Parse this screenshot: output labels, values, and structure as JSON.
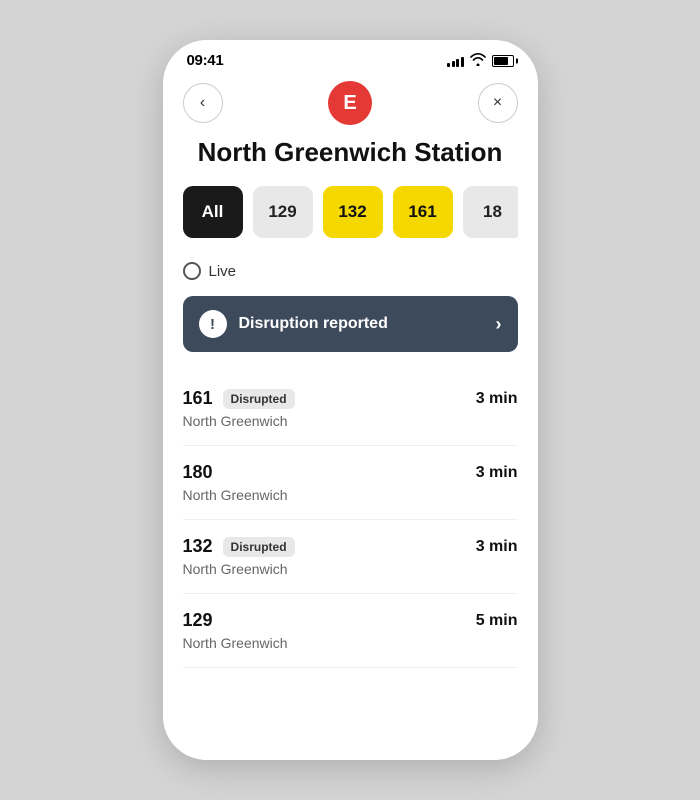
{
  "statusBar": {
    "time": "09:41",
    "locationArrow": "▶",
    "signalBars": [
      4,
      6,
      8,
      10,
      12
    ],
    "wifiSymbol": "wifi",
    "batteryFill": "80%"
  },
  "header": {
    "backLabel": "‹",
    "avatarLetter": "E",
    "closeLabel": "×"
  },
  "stationTitle": "North Greenwich Station",
  "routeTabs": [
    {
      "label": "All",
      "style": "active-black"
    },
    {
      "label": "129",
      "style": "inactive-gray"
    },
    {
      "label": "132",
      "style": "active-yellow"
    },
    {
      "label": "161",
      "style": "active-yellow"
    },
    {
      "label": "18",
      "style": "inactive-gray"
    }
  ],
  "liveLabel": "Live",
  "disruptionBanner": {
    "warningSymbol": "!",
    "text": "Disruption reported",
    "chevron": "›"
  },
  "arrivals": [
    {
      "routeNumber": "161",
      "disrupted": true,
      "disruptedLabel": "Disrupted",
      "destination": "North Greenwich",
      "time": "3 min"
    },
    {
      "routeNumber": "180",
      "disrupted": false,
      "disruptedLabel": "",
      "destination": "North Greenwich",
      "time": "3 min"
    },
    {
      "routeNumber": "132",
      "disrupted": true,
      "disruptedLabel": "Disrupted",
      "destination": "North Greenwich",
      "time": "3 min"
    },
    {
      "routeNumber": "129",
      "disrupted": false,
      "disruptedLabel": "",
      "destination": "North Greenwich",
      "time": "5 min"
    }
  ]
}
